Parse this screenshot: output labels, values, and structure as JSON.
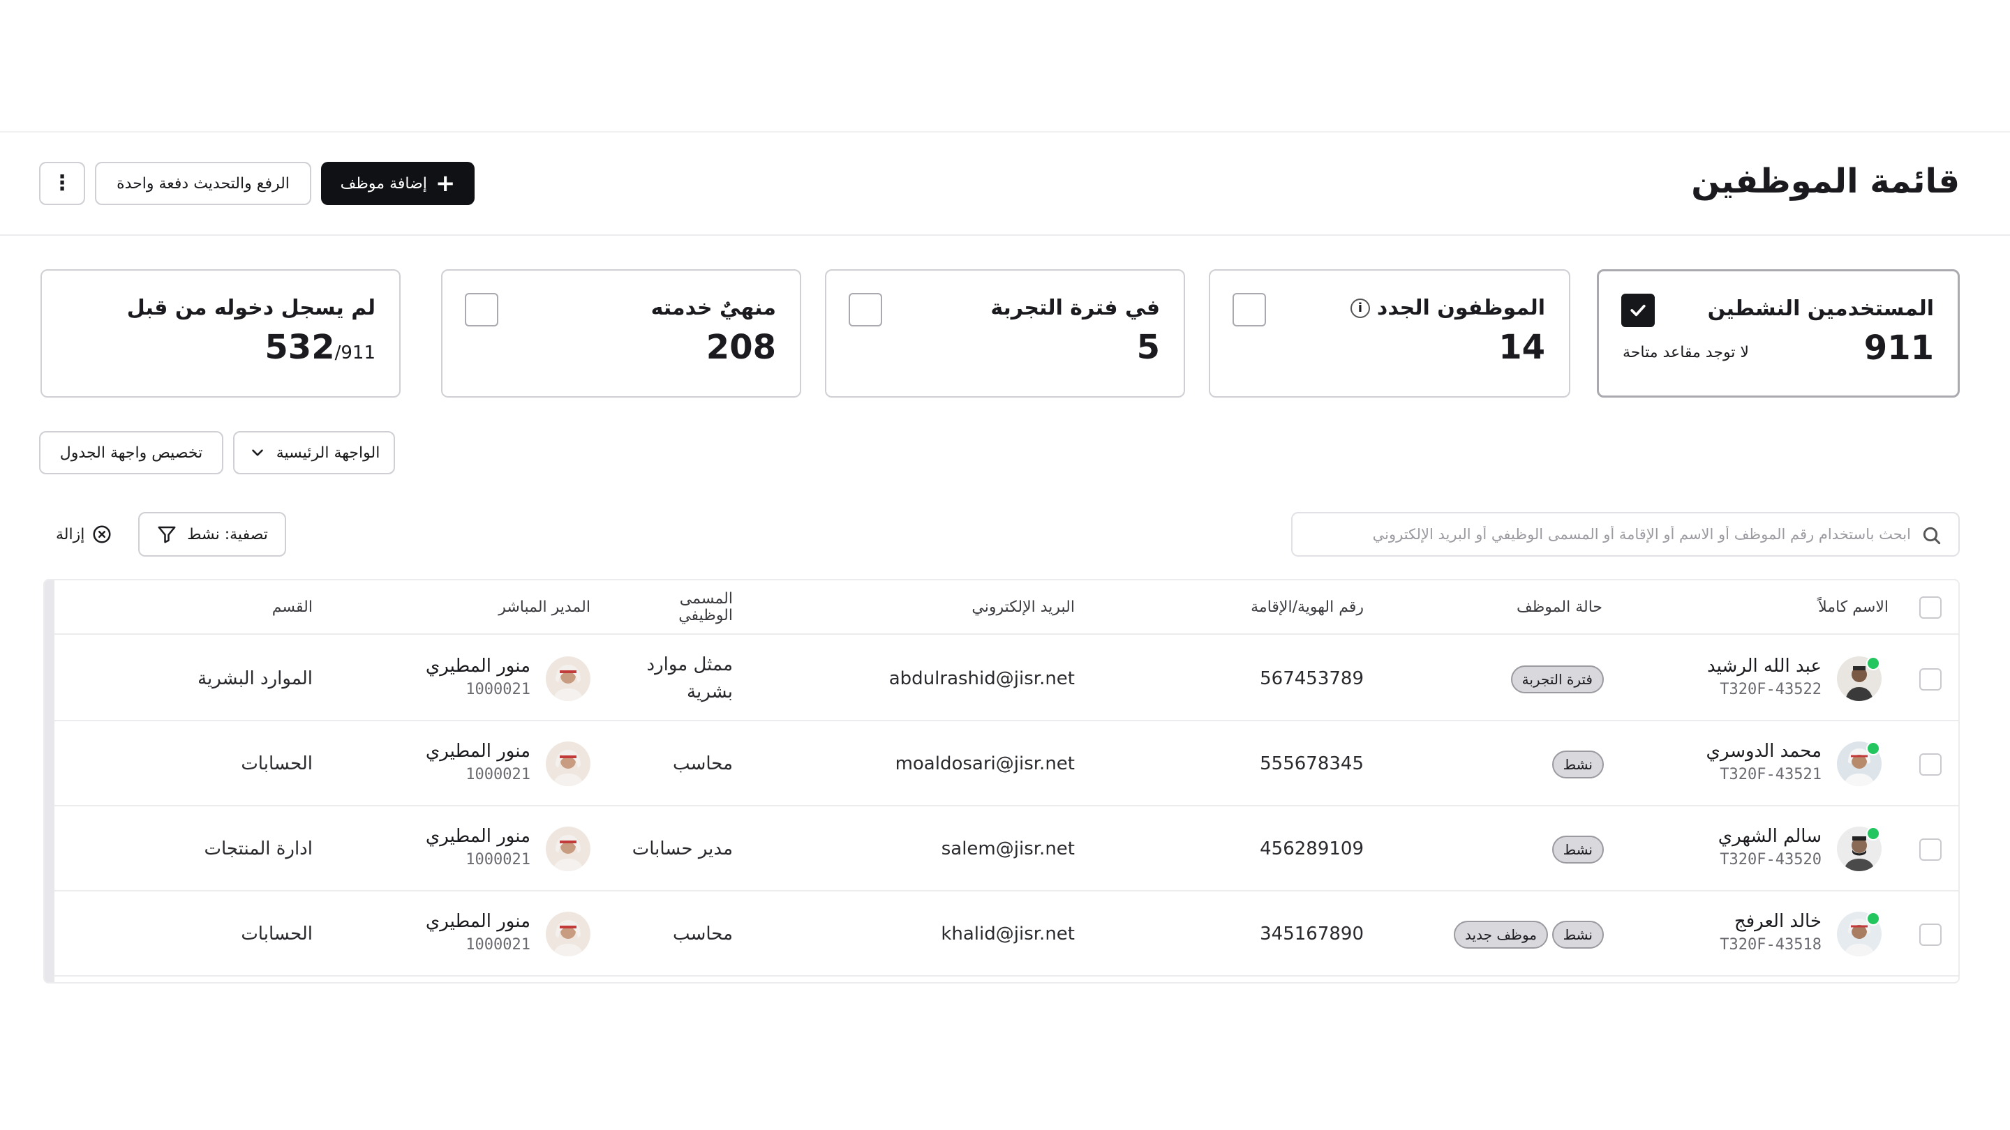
{
  "page": {
    "title": "قائمة الموظفين"
  },
  "header": {
    "add_employee_label": "إضافة موظف",
    "bulk_upload_label": "الرفع والتحديث دفعة واحدة"
  },
  "stats": [
    {
      "title": "المستخدمين النشطين",
      "value": "911",
      "note": "لا توجد مقاعد متاحة",
      "checked": true
    },
    {
      "title": "الموظفون الجدد",
      "value": "14",
      "checked": false
    },
    {
      "title": "في فترة التجربة",
      "value": "5",
      "checked": false
    },
    {
      "title": "منهيٌ خدمته",
      "value": "208",
      "checked": false
    },
    {
      "title": "لم يسجل دخوله من قبل",
      "value": "532",
      "value_suffix": "/911"
    }
  ],
  "view": {
    "main_view_label": "الواجهة الرئيسية",
    "customize_label": "تخصيص واجهة الجدول"
  },
  "search": {
    "placeholder": "ابحث باستخدام رقم الموظف أو الاسم أو الإقامة أو المسمى الوظيفي أو البريد الإلكتروني"
  },
  "filters": {
    "active_filter_label": "تصفية: نشط",
    "clear_label": "إزالة"
  },
  "table": {
    "columns": {
      "name": "الاسم كاملاً",
      "status": "حالة الموظف",
      "id_number": "رقم الهوية/الإقامة",
      "email": "البريد الإلكتروني",
      "job_title": "المسمى الوظيفي",
      "manager": "المدير المباشر",
      "department": "القسم"
    },
    "rows": [
      {
        "name": "عبد الله الرشيد",
        "code": "T320F-43522",
        "badges": [
          "فترة التجربة"
        ],
        "id_number": "567453789",
        "email": "abdulrashid@jisr.net",
        "job_title": "ممثل موارد بشرية",
        "manager_name": "منور المطيري",
        "manager_code": "1000021",
        "department": "الموارد البشرية"
      },
      {
        "name": "محمد الدوسري",
        "code": "T320F-43521",
        "badges": [
          "نشط"
        ],
        "id_number": "555678345",
        "email": "moaldosari@jisr.net",
        "job_title": "محاسب",
        "manager_name": "منور المطيري",
        "manager_code": "1000021",
        "department": "الحسابات"
      },
      {
        "name": "سالم الشهري",
        "code": "T320F-43520",
        "badges": [
          "نشط"
        ],
        "id_number": "456289109",
        "email": "salem@jisr.net",
        "job_title": "مدير حسابات",
        "manager_name": "منور المطيري",
        "manager_code": "1000021",
        "department": "ادارة المنتجات"
      },
      {
        "name": "خالد العرفج",
        "code": "T320F-43518",
        "badges": [
          "نشط",
          "موظف جديد"
        ],
        "id_number": "345167890",
        "email": "khalid@jisr.net",
        "job_title": "محاسب",
        "manager_name": "منور المطيري",
        "manager_code": "1000021",
        "department": "الحسابات"
      }
    ]
  },
  "colors": {
    "primary_button": "#101114",
    "online_dot": "#22c55e",
    "badge_bg": "#d9d9dd",
    "border": "#cfcfd4"
  },
  "icons": [
    "plus-icon",
    "more-vertical-icon",
    "check-icon",
    "info-icon",
    "chevron-down-icon",
    "search-icon",
    "filter-icon",
    "close-circle-icon"
  ]
}
